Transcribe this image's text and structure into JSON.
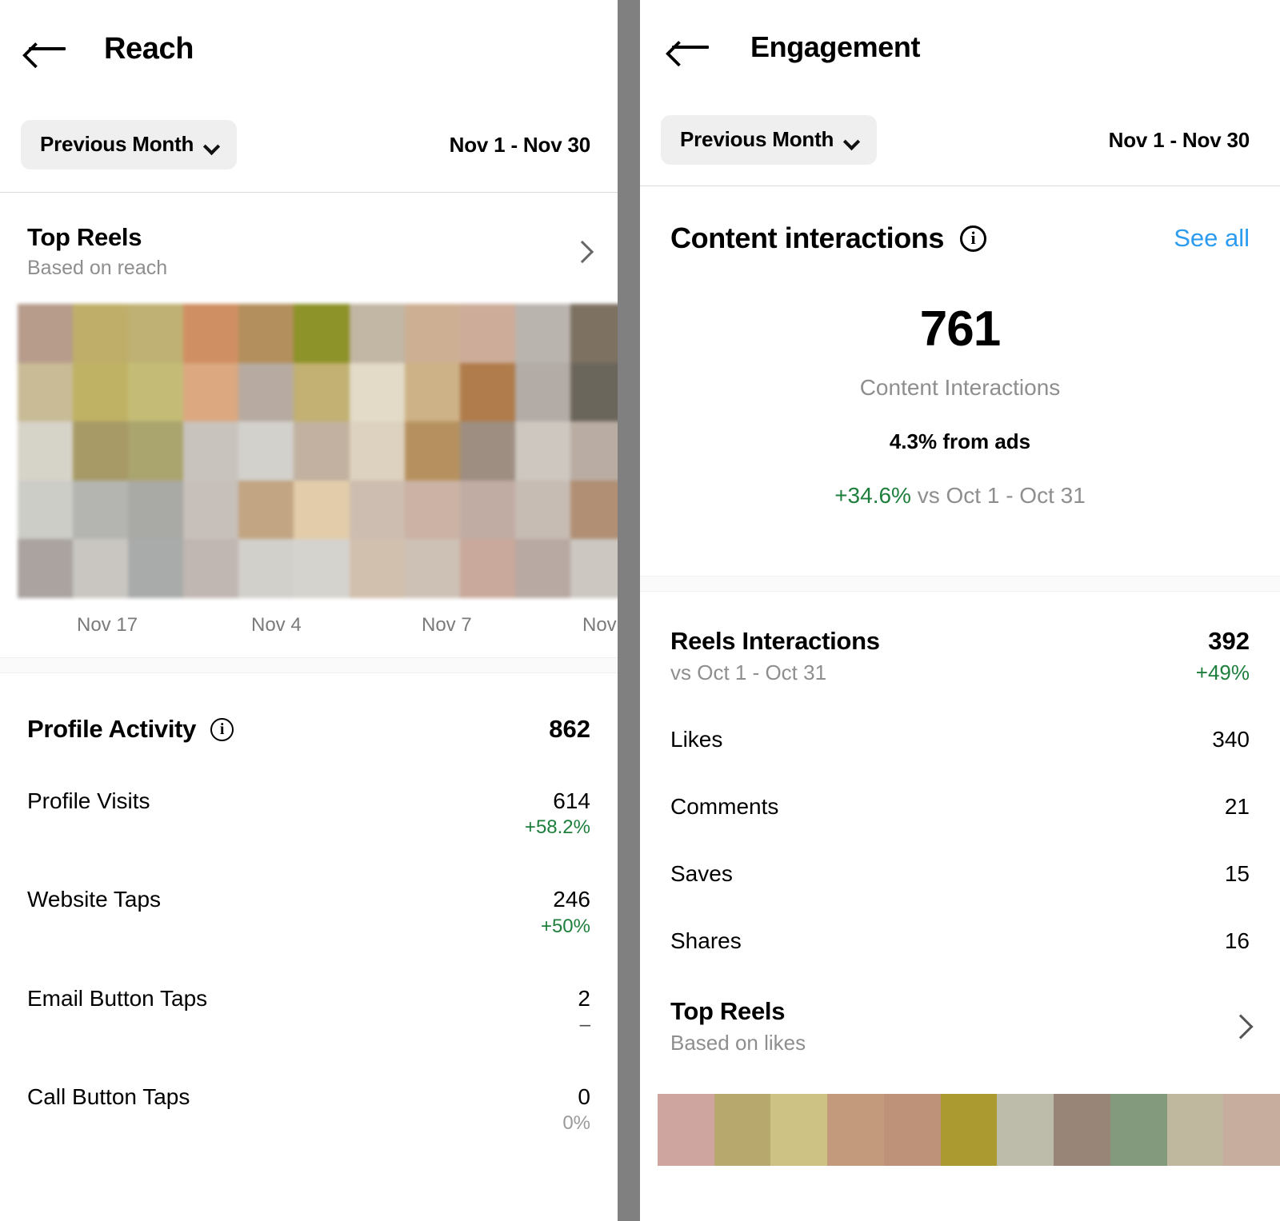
{
  "colors": {
    "accent_link": "#2b9cf0",
    "positive": "#1e7f3c",
    "muted": "#8e8e8e",
    "chip_bg": "#efefef",
    "gutter": "#808080"
  },
  "left_panel": {
    "back_icon": "back-arrow-icon",
    "title": "Reach",
    "filter": {
      "chip_label": "Previous Month",
      "chip_icon": "chevron-down-icon",
      "date_range": "Nov 1 - Nov 30"
    },
    "top_reels": {
      "title": "Top Reels",
      "subtitle": "Based on reach",
      "chevron_icon": "chevron-right-icon"
    },
    "reels_axis_labels": [
      "Nov 17",
      "Nov 4",
      "Nov 7",
      "Nov"
    ],
    "profile_activity": {
      "title": "Profile Activity",
      "info_icon": "info-icon",
      "total": "862",
      "rows": [
        {
          "name": "Profile Visits",
          "value": "614",
          "delta": "+58.2%",
          "delta_kind": "up"
        },
        {
          "name": "Website Taps",
          "value": "246",
          "delta": "+50%",
          "delta_kind": "up"
        },
        {
          "name": "Email Button Taps",
          "value": "2",
          "delta": "–",
          "delta_kind": "dash"
        },
        {
          "name": "Call Button Taps",
          "value": "0",
          "delta": "0%",
          "delta_kind": "flat"
        }
      ]
    }
  },
  "right_panel": {
    "back_icon": "back-arrow-icon",
    "title": "Engagement",
    "filter": {
      "chip_label": "Previous Month",
      "chip_icon": "chevron-down-icon",
      "date_range": "Nov 1 - Nov 30"
    },
    "content_interactions": {
      "title": "Content interactions",
      "info_icon": "info-icon",
      "see_all": "See all",
      "big_number": "761",
      "caption": "Content Interactions",
      "from_ads": "4.3% from ads",
      "change_pct": "+34.6%",
      "change_vs": "vs Oct 1 - Oct 31"
    },
    "reels_interactions": {
      "title": "Reels Interactions",
      "subtitle": "vs Oct 1 - Oct 31",
      "value": "392",
      "delta": "+49%",
      "rows": [
        {
          "name": "Likes",
          "value": "340"
        },
        {
          "name": "Comments",
          "value": "21"
        },
        {
          "name": "Saves",
          "value": "15"
        },
        {
          "name": "Shares",
          "value": "16"
        }
      ]
    },
    "top_reels": {
      "title": "Top Reels",
      "subtitle": "Based on likes",
      "chevron_icon": "chevron-right-icon"
    },
    "thumbnail_strip_colors": [
      "#cfa69f",
      "#b7a86e",
      "#cdc184",
      "#c39a7c",
      "#bd9279",
      "#ab9a2f",
      "#bdbcab",
      "#998478",
      "#849a7c",
      "#bfb79e",
      "#c6ad9e"
    ]
  },
  "chart_data": {
    "type": "heatmap",
    "title": "Top Reels mosaic (blurred thumbnail grid)",
    "xlabel": "",
    "ylabel": "",
    "grid": false,
    "legend": "none",
    "x_tick_labels": [
      "Nov 17",
      "Nov 4",
      "Nov 7",
      "Nov"
    ],
    "columns": 11,
    "rows": 5,
    "cell_colors": [
      [
        "#b79c8c",
        "#bfae6a",
        "#bfb173",
        "#d08f62",
        "#b38f5d",
        "#8d9229",
        "#c2b6a4",
        "#cdaf93",
        "#cdac99",
        "#bab4ae",
        "#7d7162"
      ],
      [
        "#c8bb96",
        "#bfb264",
        "#c4bc76",
        "#dba880",
        "#b7aaa0",
        "#c2b172",
        "#e3dbc8",
        "#cdb287",
        "#b07c4b",
        "#b3aca6",
        "#6b665c"
      ],
      [
        "#d6d3c8",
        "#a79a67",
        "#aaa46e",
        "#c9c3bd",
        "#d3d1cc",
        "#c2b1a0",
        "#ddd2bf",
        "#b6915f",
        "#9e8e81",
        "#cdc7c0",
        "#b9ada3"
      ],
      [
        "#cdcdc8",
        "#b4b5b0",
        "#a9a9a6",
        "#c7c0ba",
        "#c2a583",
        "#e2cca9",
        "#cdbdb0",
        "#cbb2a4",
        "#c1aca4",
        "#c7bcb4",
        "#b08f74"
      ],
      [
        "#aaa3a0",
        "#c9c6c1",
        "#a9abaa",
        "#c0b6b2",
        "#d2d0cb",
        "#d4d3ce",
        "#d2c0ae",
        "#cdc1b6",
        "#c9a99b",
        "#b8a9a2",
        "#ccc7c1"
      ]
    ]
  }
}
